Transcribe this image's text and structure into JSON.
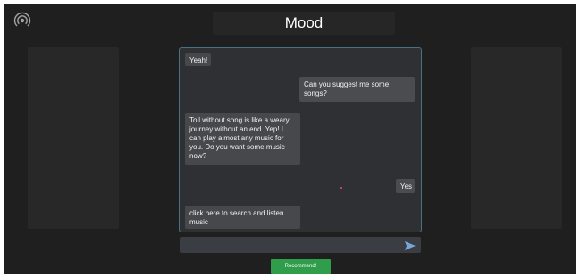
{
  "app": {
    "logo_icon": "broadcast-icon"
  },
  "header": {
    "title": "Mood"
  },
  "chat": {
    "messages": [
      {
        "sender": "bot",
        "text": "Yeah!"
      },
      {
        "sender": "user",
        "text": "Can you suggest me some\nsongs?"
      },
      {
        "sender": "bot",
        "text": "Toil without song is like a weary\njourney without an end. Yep! I\ncan play almost any music for\nyou. Do you want some music\nnow?"
      },
      {
        "sender": "user",
        "text": "Yes"
      },
      {
        "sender": "bot",
        "text": "click here to search and listen\nmusic"
      }
    ]
  },
  "composer": {
    "input_value": "",
    "input_placeholder": "",
    "send_icon": "send-icon"
  },
  "actions": {
    "recommend_label": "Recommend!"
  },
  "colors": {
    "accent_green": "#2f9d4a",
    "chat_border": "#4a6f86",
    "send_blue": "#79a6d8"
  }
}
